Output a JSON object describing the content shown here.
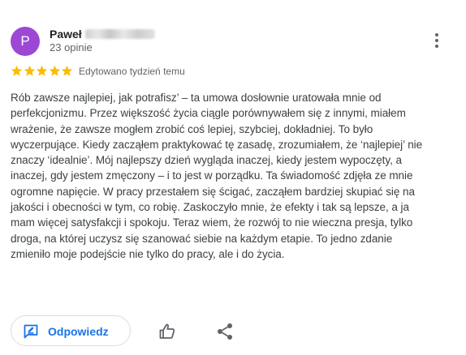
{
  "review": {
    "author": {
      "initial": "P",
      "name": "Paweł",
      "review_count": "23 opinie",
      "avatar_color": "#9c48d4"
    },
    "rating": 5,
    "star_color": "#fbbc04",
    "edited": "Edytowano tydzień temu",
    "text": "Rób zawsze najlepiej, jak potrafisz’ – ta umowa dosłownie uratowała mnie od perfekcjonizmu. Przez większość życia ciągle porównywałem się z innymi, miałem wrażenie, że zawsze mogłem zrobić coś lepiej, szybciej, dokładniej. To było wyczerpujące. Kiedy zacząłem praktykować tę zasadę, zrozumiałem, że ‘najlepiej’ nie znaczy ‘idealnie’. Mój najlepszy dzień wygląda inaczej, kiedy jestem wypoczęty, a inaczej, gdy jestem zmęczony – i to jest w porządku. Ta świadomość zdjęła ze mnie ogromne napięcie. W pracy przestałem się ścigać, zacząłem bardziej skupiać się na jakości i obecności w tym, co robię. Zaskoczyło mnie, że efekty i tak są lepsze, a ja mam więcej satysfakcji i spokoju. Teraz wiem, że rozwój to nie wieczna presja, tylko droga, na której uczysz się szanować siebie na każdym etapie. To jedno zdanie zmieniło moje podejście nie tylko do pracy, ale i do życia."
  },
  "actions": {
    "reply_label": "Odpowiedz",
    "accent_color": "#1a73e8",
    "icons": {
      "more": "more-vert-icon",
      "reply": "reply-icon",
      "like": "thumb-up-icon",
      "share": "share-icon"
    }
  }
}
